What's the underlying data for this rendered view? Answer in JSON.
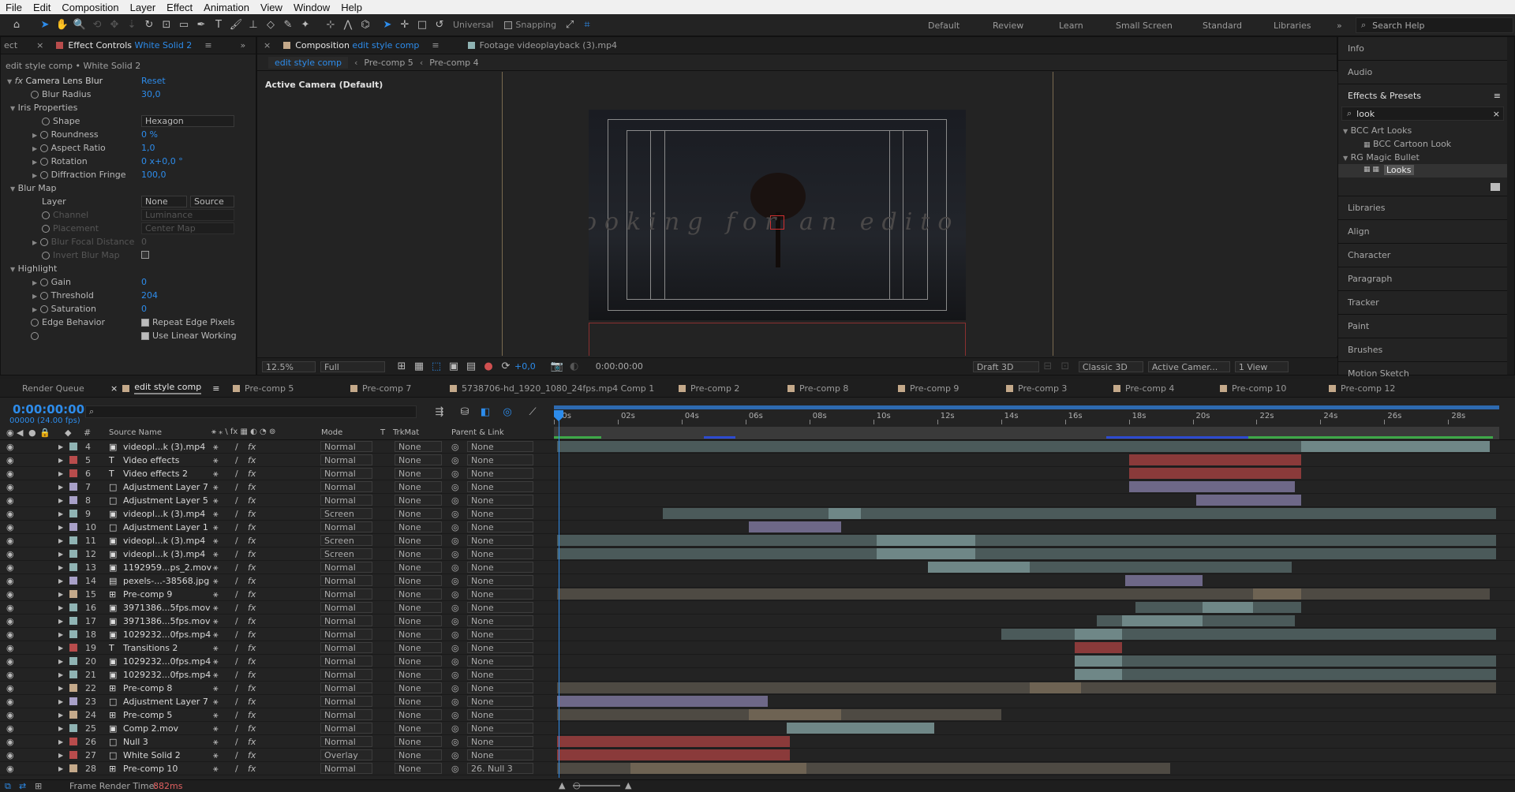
{
  "menu": [
    "File",
    "Edit",
    "Composition",
    "Layer",
    "Effect",
    "Animation",
    "View",
    "Window",
    "Help"
  ],
  "toolbar": {
    "universal_label": "Universal",
    "snapping_label": "Snapping",
    "workspaces": [
      "Default",
      "Review",
      "Learn",
      "Small Screen",
      "Standard",
      "Libraries"
    ],
    "search_placeholder": "Search Help"
  },
  "effect_controls": {
    "tab_prefix": "ect",
    "tab_label": "Effect Controls",
    "tab_layer": "White Solid 2",
    "breadcrumb": "edit style comp • White Solid 2",
    "effect_name": "Camera Lens Blur",
    "reset_label": "Reset",
    "rows": [
      {
        "label": "Blur Radius",
        "value": "30,0"
      },
      {
        "label": "Iris Properties"
      },
      {
        "label": "Shape",
        "value": "Hexagon"
      },
      {
        "label": "Roundness",
        "value": "0 %"
      },
      {
        "label": "Aspect Ratio",
        "value": "1,0"
      },
      {
        "label": "Rotation",
        "value": "0 x+0,0 °"
      },
      {
        "label": "Diffraction Fringe",
        "value": "100,0"
      },
      {
        "label": "Blur Map"
      },
      {
        "label": "Layer",
        "value": "None",
        "value2": "Source"
      },
      {
        "label": "Channel",
        "value": "Luminance"
      },
      {
        "label": "Placement",
        "value": "Center Map"
      },
      {
        "label": "Blur Focal Distance",
        "value": "0"
      },
      {
        "label": "Invert Blur Map"
      },
      {
        "label": "Highlight"
      },
      {
        "label": "Gain",
        "value": "0"
      },
      {
        "label": "Threshold",
        "value": "204"
      },
      {
        "label": "Saturation",
        "value": "0"
      },
      {
        "label": "Edge Behavior",
        "value": "Repeat Edge Pixels"
      },
      {
        "value": "Use Linear Working"
      }
    ]
  },
  "composition": {
    "tab_label": "Composition",
    "tab_comp": "edit style comp",
    "footage_tab": "Footage videoplayback (3).mp4",
    "flow": [
      "edit style comp",
      "Pre-comp 5",
      "Pre-comp 4"
    ],
    "camera_label": "Active Camera (Default)",
    "overlay_text": "ooking for an edito",
    "footer": {
      "zoom": "12.5%",
      "resolution": "Full",
      "exposure": "+0,0",
      "timecode": "0:00:00:00",
      "draft": "Draft 3D",
      "renderer": "Classic 3D",
      "camera": "Active Camer...",
      "views": "1 View"
    }
  },
  "right_panel": {
    "info": "Info",
    "audio": "Audio",
    "effects_presets": "Effects & Presets",
    "search_value": "look",
    "tree": [
      {
        "label": "BCC Art Looks"
      },
      {
        "label": "BCC Cartoon Look"
      },
      {
        "label": "RG Magic Bullet"
      },
      {
        "label": "Looks"
      }
    ],
    "panels": [
      "Libraries",
      "Align",
      "Character",
      "Paragraph",
      "Tracker",
      "Paint",
      "Brushes",
      "Motion Sketch"
    ]
  },
  "timeline": {
    "tabs": [
      "Render Queue",
      "edit style comp",
      "Pre-comp 5",
      "Pre-comp 7",
      "5738706-hd_1920_1080_24fps.mp4 Comp 1",
      "Pre-comp 2",
      "Pre-comp 8",
      "Pre-comp 9",
      "Pre-comp 3",
      "Pre-comp 4",
      "Pre-comp 10",
      "Pre-comp 12"
    ],
    "timecode": "0:00:00:00",
    "frame_info": "00000 (24.00 fps)",
    "col_source": "Source Name",
    "col_mode": "Mode",
    "col_t": "T",
    "col_trkmat": "TrkMat",
    "col_parent": "Parent & Link",
    "ruler": [
      "00s",
      "02s",
      "04s",
      "06s",
      "08s",
      "10s",
      "12s",
      "14s",
      "16s",
      "18s",
      "20s",
      "22s",
      "24s",
      "26s",
      "28s"
    ],
    "layers": [
      {
        "n": "4",
        "name": "videopl...k (3).mp4",
        "mode": "Normal",
        "trk": "None",
        "parent": "None",
        "color": "#8fb3b3",
        "type": "footage",
        "bars": [
          [
            0,
            23.3,
            "#4b5a5a"
          ],
          [
            23.3,
            29.2,
            "#6f8787"
          ]
        ]
      },
      {
        "n": "5",
        "name": "Video effects",
        "mode": "Normal",
        "trk": "None",
        "parent": "None",
        "color": "#b84c4c",
        "type": "text",
        "bars": [
          [
            17.9,
            23.3,
            "#8a3a3a"
          ]
        ]
      },
      {
        "n": "6",
        "name": "Video effects 2",
        "mode": "Normal",
        "trk": "None",
        "parent": "None",
        "color": "#b84c4c",
        "type": "text",
        "bars": [
          [
            17.9,
            23.3,
            "#8a3a3a"
          ]
        ]
      },
      {
        "n": "7",
        "name": "Adjustment Layer 7",
        "mode": "Normal",
        "trk": "None",
        "parent": "None",
        "color": "#a8a0c8",
        "type": "solid",
        "bars": [
          [
            17.9,
            23.1,
            "#6e6888"
          ]
        ]
      },
      {
        "n": "8",
        "name": "Adjustment Layer 5",
        "mode": "Normal",
        "trk": "None",
        "parent": "None",
        "color": "#a8a0c8",
        "type": "solid",
        "bars": [
          [
            20.0,
            23.3,
            "#6e6888"
          ]
        ]
      },
      {
        "n": "9",
        "name": "videopl...k (3).mp4",
        "mode": "Screen",
        "trk": "None",
        "parent": "None",
        "color": "#8fb3b3",
        "type": "footage",
        "bars": [
          [
            3.3,
            8.5,
            "#4b5a5a"
          ],
          [
            8.5,
            9.5,
            "#6f8787"
          ],
          [
            9.5,
            29.4,
            "#4b5a5a"
          ]
        ]
      },
      {
        "n": "10",
        "name": "Adjustment Layer 1",
        "mode": "Normal",
        "trk": "None",
        "parent": "None",
        "color": "#a8a0c8",
        "type": "solid",
        "bars": [
          [
            6.0,
            8.9,
            "#6e6888"
          ]
        ]
      },
      {
        "n": "11",
        "name": "videopl...k (3).mp4",
        "mode": "Screen",
        "trk": "None",
        "parent": "None",
        "color": "#8fb3b3",
        "type": "footage",
        "bars": [
          [
            0,
            10.0,
            "#4b5a5a"
          ],
          [
            10.0,
            13.1,
            "#6f8787"
          ],
          [
            13.1,
            29.4,
            "#4b5a5a"
          ]
        ]
      },
      {
        "n": "12",
        "name": "videopl...k (3).mp4",
        "mode": "Screen",
        "trk": "None",
        "parent": "None",
        "color": "#8fb3b3",
        "type": "footage",
        "bars": [
          [
            0,
            10.0,
            "#4b5a5a"
          ],
          [
            10.0,
            13.1,
            "#6f8787"
          ],
          [
            13.1,
            29.4,
            "#4b5a5a"
          ]
        ]
      },
      {
        "n": "13",
        "name": "1192959...ps_2.mov",
        "mode": "Normal",
        "trk": "None",
        "parent": "None",
        "color": "#8fb3b3",
        "type": "footage",
        "bars": [
          [
            11.6,
            14.8,
            "#6f8787"
          ],
          [
            14.8,
            23.0,
            "#4b5a5a"
          ]
        ]
      },
      {
        "n": "14",
        "name": "pexels-...-38568.jpg",
        "mode": "Normal",
        "trk": "None",
        "parent": "None",
        "color": "#a8a0c8",
        "type": "image",
        "bars": [
          [
            17.8,
            20.2,
            "#6e6888"
          ]
        ]
      },
      {
        "n": "15",
        "name": "Pre-comp 9",
        "mode": "Normal",
        "trk": "None",
        "parent": "None",
        "color": "#c4a98a",
        "type": "comp",
        "bars": [
          [
            0,
            21.8,
            "#4e4a43"
          ],
          [
            21.8,
            23.3,
            "#6e6353"
          ],
          [
            23.3,
            29.2,
            "#4e4a43"
          ]
        ]
      },
      {
        "n": "16",
        "name": "3971386...5fps.mov",
        "mode": "Normal",
        "trk": "None",
        "parent": "None",
        "color": "#8fb3b3",
        "type": "footage",
        "bars": [
          [
            18.1,
            20.2,
            "#4b5a5a"
          ],
          [
            20.2,
            21.8,
            "#6f8787"
          ],
          [
            21.8,
            23.3,
            "#4b5a5a"
          ]
        ]
      },
      {
        "n": "17",
        "name": "3971386...5fps.mov",
        "mode": "Normal",
        "trk": "None",
        "parent": "None",
        "color": "#8fb3b3",
        "type": "footage",
        "bars": [
          [
            16.9,
            17.7,
            "#4b5a5a"
          ],
          [
            17.7,
            20.2,
            "#6f8787"
          ],
          [
            20.2,
            23.1,
            "#4b5a5a"
          ]
        ]
      },
      {
        "n": "18",
        "name": "1029232...0fps.mp4",
        "mode": "Normal",
        "trk": "None",
        "parent": "None",
        "color": "#8fb3b3",
        "type": "footage",
        "bars": [
          [
            13.9,
            16.2,
            "#4b5a5a"
          ],
          [
            16.2,
            17.7,
            "#6f8787"
          ],
          [
            17.7,
            29.4,
            "#4b5a5a"
          ]
        ]
      },
      {
        "n": "19",
        "name": "Transitions 2",
        "mode": "Normal",
        "trk": "None",
        "parent": "None",
        "color": "#b84c4c",
        "type": "text",
        "bars": [
          [
            16.2,
            17.7,
            "#8a3a3a"
          ]
        ]
      },
      {
        "n": "20",
        "name": "1029232...0fps.mp4",
        "mode": "Normal",
        "trk": "None",
        "parent": "None",
        "color": "#8fb3b3",
        "type": "footage",
        "bars": [
          [
            16.2,
            17.7,
            "#6f8787"
          ],
          [
            17.7,
            29.4,
            "#4b5a5a"
          ]
        ]
      },
      {
        "n": "21",
        "name": "1029232...0fps.mp4",
        "mode": "Normal",
        "trk": "None",
        "parent": "None",
        "color": "#8fb3b3",
        "type": "footage",
        "bars": [
          [
            16.2,
            17.7,
            "#6f8787"
          ],
          [
            17.7,
            29.4,
            "#4b5a5a"
          ]
        ]
      },
      {
        "n": "22",
        "name": "Pre-comp 8",
        "mode": "Normal",
        "trk": "None",
        "parent": "None",
        "color": "#c4a98a",
        "type": "comp",
        "bars": [
          [
            0,
            14.8,
            "#4e4a43"
          ],
          [
            14.8,
            16.4,
            "#6e6353"
          ],
          [
            16.4,
            29.4,
            "#4e4a43"
          ]
        ]
      },
      {
        "n": "23",
        "name": "Adjustment Layer 7",
        "mode": "Normal",
        "trk": "None",
        "parent": "None",
        "color": "#a8a0c8",
        "type": "solid",
        "bars": [
          [
            0,
            6.6,
            "#6e6888"
          ]
        ]
      },
      {
        "n": "24",
        "name": "Pre-comp 5",
        "mode": "Normal",
        "trk": "None",
        "parent": "None",
        "color": "#c4a98a",
        "type": "comp",
        "bars": [
          [
            0,
            6.0,
            "#4e4a43"
          ],
          [
            6.0,
            8.9,
            "#6e6353"
          ],
          [
            8.9,
            13.9,
            "#4e4a43"
          ]
        ]
      },
      {
        "n": "25",
        "name": "Comp 2.mov",
        "mode": "Normal",
        "trk": "None",
        "parent": "None",
        "color": "#8fb3b3",
        "type": "footage",
        "bars": [
          [
            7.2,
            11.8,
            "#6f8787"
          ]
        ]
      },
      {
        "n": "26",
        "name": "Null 3",
        "mode": "Normal",
        "trk": "None",
        "parent": "None",
        "color": "#b84c4c",
        "type": "null",
        "bars": [
          [
            0,
            7.3,
            "#8a3a3a"
          ]
        ]
      },
      {
        "n": "27",
        "name": "White Solid 2",
        "mode": "Overlay",
        "trk": "None",
        "parent": "None",
        "color": "#b84c4c",
        "type": "solid",
        "bars": [
          [
            0,
            7.3,
            "#8a3a3a"
          ]
        ]
      },
      {
        "n": "28",
        "name": "Pre-comp 10",
        "mode": "Normal",
        "trk": "None",
        "parent": "26. Null 3",
        "color": "#c4a98a",
        "type": "comp",
        "bars": [
          [
            0,
            2.3,
            "#4e4a43"
          ],
          [
            2.3,
            7.8,
            "#6e6353"
          ],
          [
            7.8,
            19.2,
            "#4e4a43"
          ]
        ]
      }
    ]
  },
  "status": {
    "render_label": "Frame Render Time:",
    "render_time": "882ms"
  }
}
